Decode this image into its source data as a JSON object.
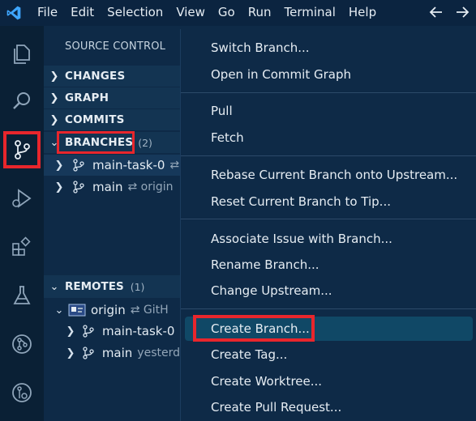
{
  "menubar": {
    "items": [
      "File",
      "Edit",
      "Selection",
      "View",
      "Go",
      "Run",
      "Terminal",
      "Help"
    ]
  },
  "sidebar": {
    "title": "SOURCE CONTROL",
    "sections": {
      "changes": "CHANGES",
      "graph": "GRAPH",
      "commits": "COMMITS",
      "branches": "BRANCHES",
      "branches_count": "(2)",
      "remotes": "REMOTES",
      "remotes_count": "(1)"
    },
    "branches": [
      {
        "name": "main-task-0",
        "desc": "⇄"
      },
      {
        "name": "main",
        "desc": "⇄ origin"
      }
    ],
    "remote": {
      "name": "origin",
      "desc": "⇄ GitH"
    },
    "remote_branches": [
      {
        "name": "main-task-0",
        "desc": ""
      },
      {
        "name": "main",
        "desc": "yesterd"
      }
    ]
  },
  "context_menu": {
    "group1": [
      "Switch Branch...",
      "Open in Commit Graph"
    ],
    "group2": [
      "Pull",
      "Fetch"
    ],
    "group3": [
      "Rebase Current Branch onto Upstream...",
      "Reset Current Branch to Tip..."
    ],
    "group4": [
      "Associate Issue with Branch...",
      "Rename Branch...",
      "Change Upstream..."
    ],
    "group5": [
      "Create Branch...",
      "Create Tag...",
      "Create Worktree...",
      "Create Pull Request..."
    ]
  },
  "colors": {
    "accent_highlight": "#e8262c",
    "menu_hover": "#104866",
    "vscode_blue": "#3ea6ff"
  }
}
